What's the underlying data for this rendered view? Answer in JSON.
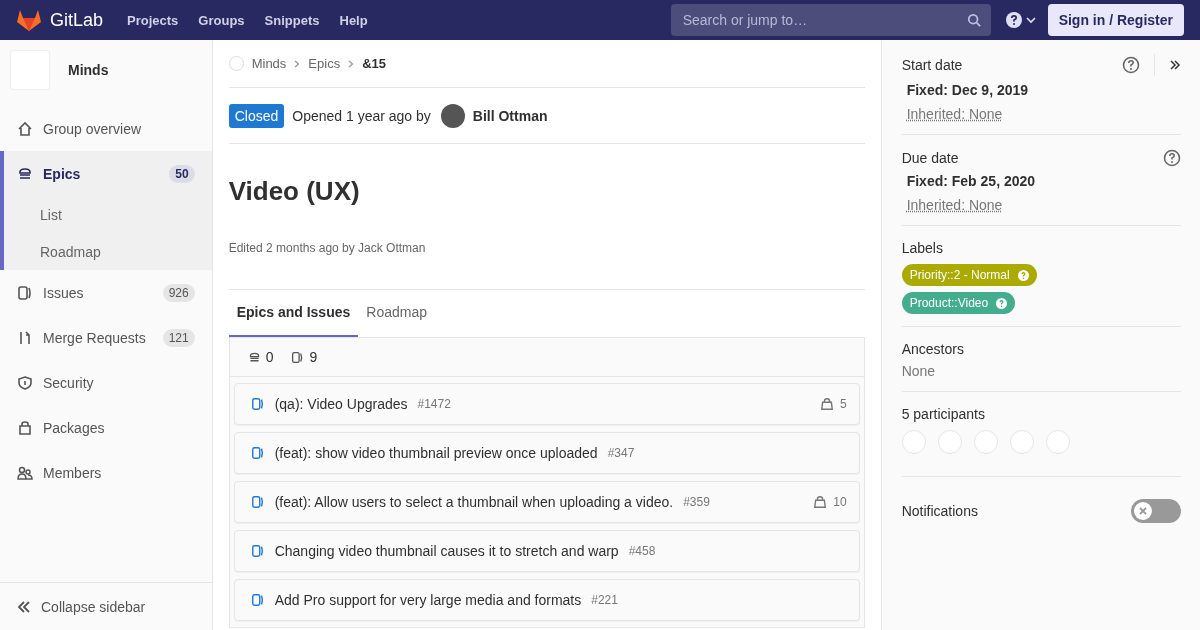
{
  "header": {
    "logo_text": "GitLab",
    "nav": [
      "Projects",
      "Groups",
      "Snippets",
      "Help"
    ],
    "search": {
      "placeholder": "Search or jump to…"
    },
    "sign_in": "Sign in / Register"
  },
  "sidebar": {
    "group_name": "Minds",
    "items": [
      {
        "label": "Group overview",
        "selected": false
      },
      {
        "label": "Epics",
        "count": "50",
        "selected": true,
        "children": [
          {
            "label": "List",
            "selected": false
          },
          {
            "label": "Roadmap",
            "selected": false
          }
        ]
      },
      {
        "label": "Issues",
        "count": "926",
        "selected": false
      },
      {
        "label": "Merge Requests",
        "count": "121",
        "selected": false
      },
      {
        "label": "Security",
        "selected": false
      },
      {
        "label": "Packages",
        "selected": false
      },
      {
        "label": "Members",
        "selected": false
      }
    ],
    "collapse": "Collapse sidebar"
  },
  "breadcrumb": [
    "Minds",
    "Epics",
    "&15"
  ],
  "status": {
    "label": "Closed",
    "opened": "Opened 1 year ago by",
    "author": "Bill Ottman"
  },
  "title": "Video (UX)",
  "edited": "Edited 2 months ago by Jack Ottman",
  "tabs": [
    {
      "label": "Epics and Issues",
      "selected": true
    },
    {
      "label": "Roadmap",
      "selected": false
    }
  ],
  "counts": {
    "epics": "0",
    "issues": "9"
  },
  "issues": [
    {
      "title": "(qa): Video Upgrades",
      "ref": "#1472",
      "weight": "5"
    },
    {
      "title": "(feat): show video thumbnail preview once uploaded",
      "ref": "#347"
    },
    {
      "title": "(feat): Allow users to select a thumbnail when uploading a video.",
      "ref": "#359",
      "weight": "10"
    },
    {
      "title": "Changing video thumbnail causes it to stretch and warp",
      "ref": "#458"
    },
    {
      "title": "Add Pro support for very large media and formats",
      "ref": "#221"
    }
  ],
  "right": {
    "start_date": {
      "label": "Start date",
      "fixed": "Fixed: Dec 9, 2019",
      "inherited": "Inherited: None"
    },
    "due_date": {
      "label": "Due date",
      "fixed": "Fixed: Feb 25, 2020",
      "inherited": "Inherited: None"
    },
    "labels": {
      "label": "Labels",
      "items": [
        {
          "text": "Priority::2 - Normal",
          "color": "#aaaa00"
        },
        {
          "text": "Product::Video",
          "color": "#44ad8e"
        }
      ]
    },
    "ancestors": {
      "label": "Ancestors",
      "value": "None"
    },
    "participants": {
      "label": "5 participants"
    },
    "notifications": {
      "label": "Notifications",
      "on": false
    }
  }
}
